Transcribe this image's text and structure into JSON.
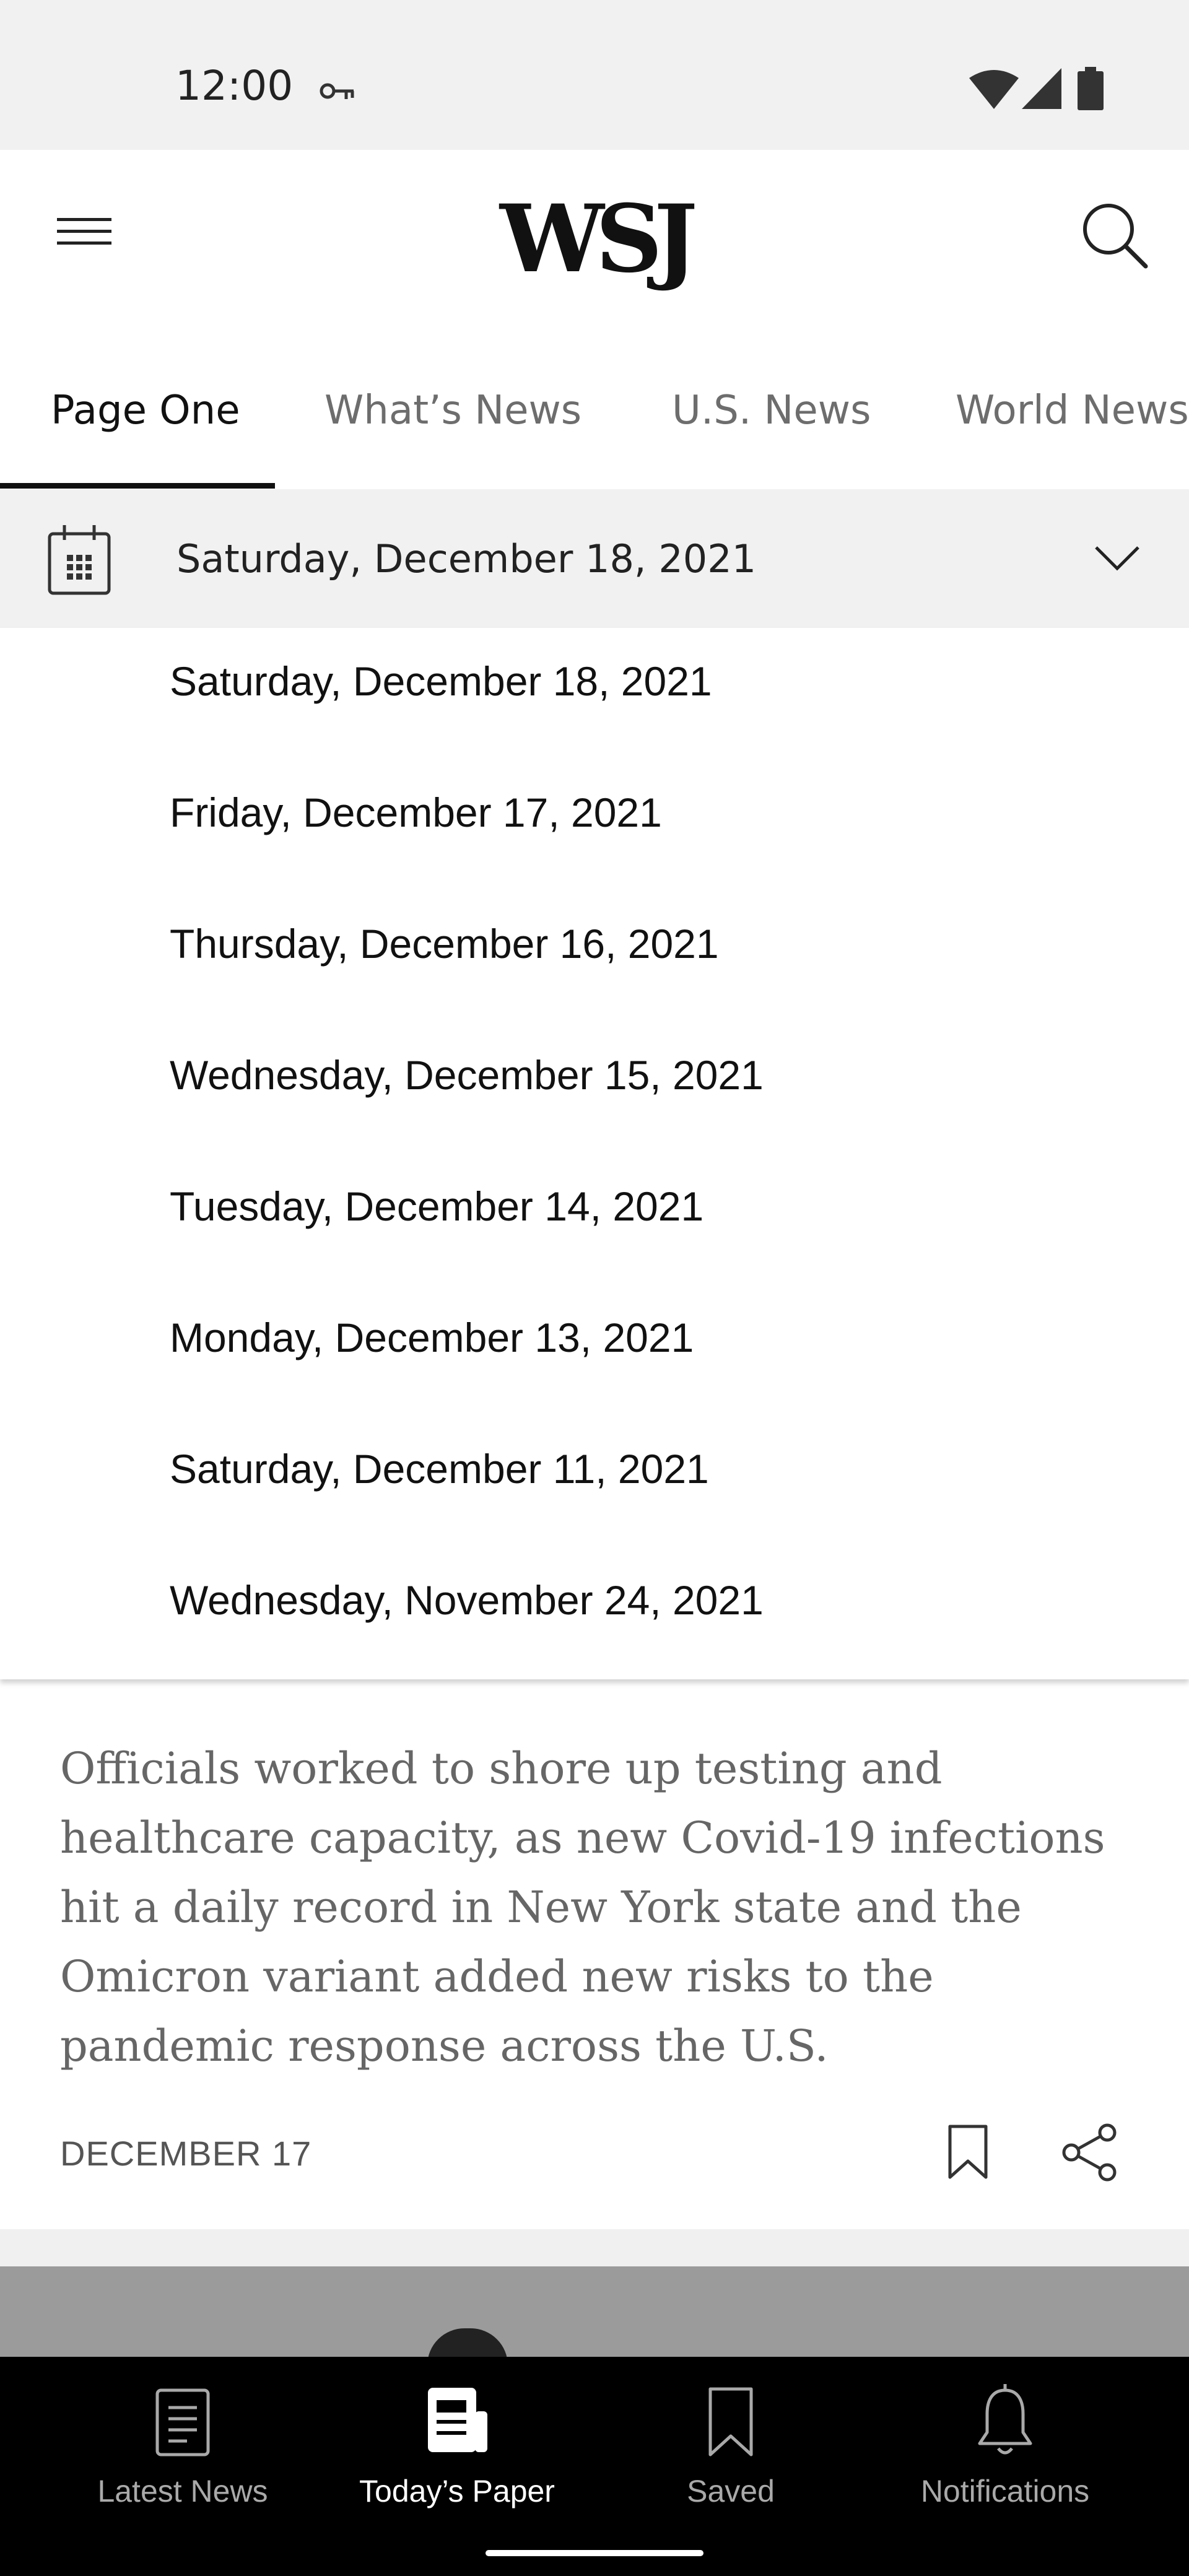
{
  "status_bar": {
    "time": "12:00"
  },
  "header": {
    "logo": "WSJ"
  },
  "tabs": [
    {
      "label": "Page One",
      "active": true
    },
    {
      "label": "What’s News",
      "active": false
    },
    {
      "label": "U.S. News",
      "active": false
    },
    {
      "label": "World News",
      "active": false
    }
  ],
  "date_selector": {
    "selected": "Saturday, December 18, 2021"
  },
  "date_options": [
    "Saturday, December 18, 2021",
    "Friday, December 17, 2021",
    "Thursday, December 16, 2021",
    "Wednesday, December 15, 2021",
    "Tuesday, December 14, 2021",
    "Monday, December 13, 2021",
    "Saturday, December 11, 2021",
    "Wednesday, November 24, 2021"
  ],
  "article": {
    "summary": "Officials worked to shore up testing and healthcare capacity, as new Covid-19 infections hit a daily record in New York state and the Omicron variant added new risks to the pandemic response across the U.S.",
    "date": "DECEMBER 17"
  },
  "bottom_nav": {
    "items": [
      {
        "label": "Latest News",
        "icon": "latest-news-icon",
        "active": false
      },
      {
        "label": "Today’s Paper",
        "icon": "todays-paper-icon",
        "active": true
      },
      {
        "label": "Saved",
        "icon": "bookmark-icon",
        "active": false
      },
      {
        "label": "Notifications",
        "icon": "bell-icon",
        "active": false
      }
    ]
  },
  "colors": {
    "background": "#ffffff",
    "header_gray": "#f1f1f1",
    "nav_background": "#000000",
    "active_text": "#111111",
    "muted_text": "#6d6d6d"
  }
}
